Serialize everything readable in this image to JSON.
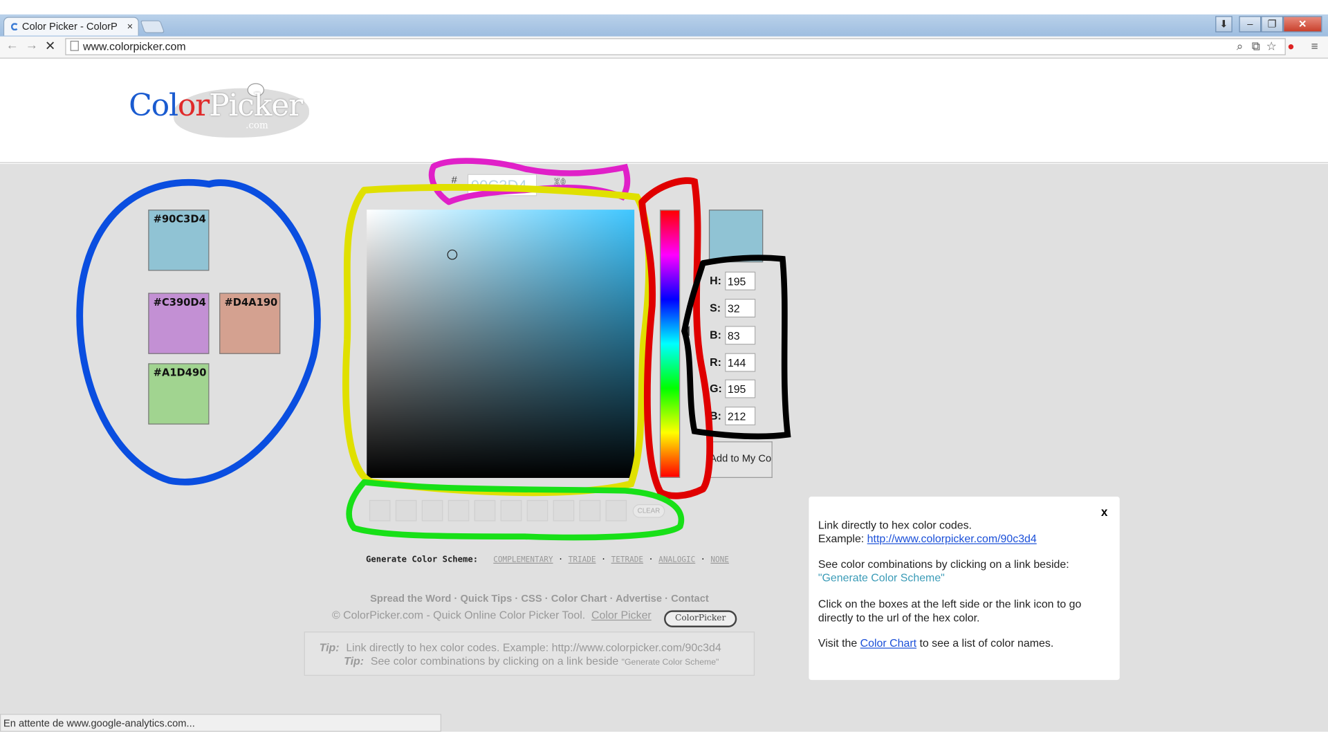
{
  "browser": {
    "tab_title": "Color Picker - ColorP",
    "tab_close": "×",
    "url": "www.colorpicker.com",
    "status": "En attente de www.google-analytics.com..."
  },
  "logo": {
    "text_a": "Col",
    "text_b": "or",
    "text_c": "Picker",
    "sub": ".com"
  },
  "saved_colors": [
    {
      "hex": "#90C3D4",
      "color": "#90c3d4"
    },
    {
      "hex": "#C390D4",
      "color": "#c390d4"
    },
    {
      "hex": "#D4A190",
      "color": "#d4a190"
    },
    {
      "hex": "#A1D490",
      "color": "#a1d490"
    }
  ],
  "picker": {
    "hash": "#",
    "hex_value": "90C3D4",
    "current_color": "#90c3d4",
    "fields": [
      {
        "label": "H:",
        "value": "195"
      },
      {
        "label": "S:",
        "value": "32"
      },
      {
        "label": "B:",
        "value": "83"
      },
      {
        "label": "R:",
        "value": "144"
      },
      {
        "label": "G:",
        "value": "195"
      },
      {
        "label": "B:",
        "value": "212"
      }
    ],
    "add_button": "Add to My Colors",
    "clear": "CLEAR"
  },
  "scheme": {
    "label": "Generate Color Scheme:",
    "options": [
      "COMPLEMENTARY",
      "TRIADE",
      "TETRADE",
      "ANALOGIC",
      "NONE"
    ]
  },
  "footer": {
    "links": [
      "Spread the Word",
      "Quick Tips",
      "CSS",
      "Color Chart",
      "Advertise",
      "Contact"
    ],
    "copyright": "© ColorPicker.com - Quick Online Color Picker Tool.",
    "color_picker_link": "Color Picker",
    "badge": "ColorPicker",
    "tips": [
      {
        "label": "Tip:",
        "text": "Link directly to hex color codes.    Example: http://www.colorpicker.com/90c3d4"
      },
      {
        "label": "Tip:",
        "text": "See color combinations by clicking on a link beside",
        "quote": "\"Generate Color Scheme\""
      }
    ]
  },
  "popup": {
    "close": "x",
    "p1_line1": "Link directly to hex color codes.",
    "p1_line2": "Example:",
    "p1_link": "http://www.colorpicker.com/90c3d4",
    "p2_line1": "See color combinations by clicking on a link beside:",
    "p2_quote": "\"Generate Color Scheme\"",
    "p3": "Click on the boxes at the left side or the link icon to go directly to the url of the hex color.",
    "p4_a": "Visit the",
    "p4_link": "Color Chart",
    "p4_b": "to see a list of color names."
  },
  "annotation_colors": {
    "blue": "#0a4ee0",
    "magenta": "#e020c8",
    "yellow": "#e0e000",
    "red": "#e00000",
    "black": "#000000",
    "green": "#18e018"
  }
}
